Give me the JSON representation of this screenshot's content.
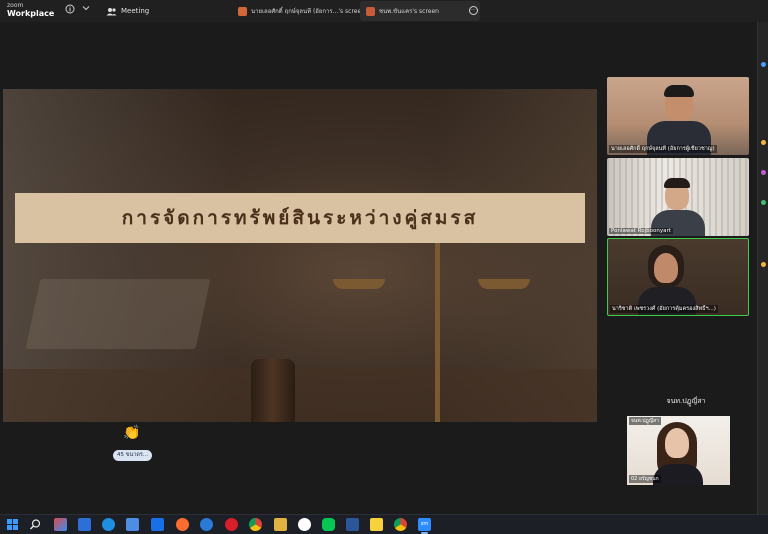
{
  "titlebar": {
    "brand_top": "zoom",
    "brand_bottom": "Workplace",
    "info_icon": "info-icon",
    "chevron_icon": "chevron-down-icon",
    "meeting_label": "Meeting",
    "screen_tabs": [
      {
        "label": "นายเลอศักดิ์ ฤกษ์จุลนที (อัยการ...'s screen",
        "active": false
      },
      {
        "label": "ชนพ.ขันแคร's screen",
        "active": true
      }
    ]
  },
  "slide": {
    "title": "การจัดการทรัพย์สินระหว่างคู่สมรส"
  },
  "reaction": {
    "emoji": "👏",
    "count_label": "45 ขนาดร..."
  },
  "participants": [
    {
      "name": "นายเลอศักดิ์ ฤกษ์จุลนที (อัยการผู้เชี่ยวชาญ)"
    },
    {
      "name": "Ponlawat Rojboonyart"
    },
    {
      "name": "นาริชาติ เพชรวงศ์ (อัยการคุ้มครองสิทธิ์ฯ...)"
    }
  ],
  "pinned": {
    "label": "จนท.ปฏูญี่สา",
    "tag": "จนท.ปฏูญี่สา",
    "name": "02 ยรัญชนก"
  },
  "colors": {
    "active_speaker": "#3dcc4a",
    "banner": "#d9c2a1",
    "banner_text": "#4a2f1a"
  }
}
